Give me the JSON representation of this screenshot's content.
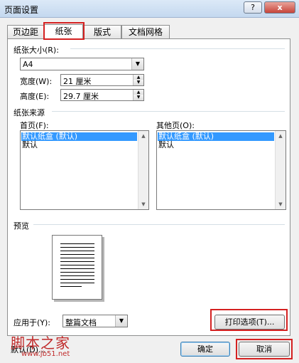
{
  "window": {
    "title": "页面设置",
    "help_label": "?",
    "close_label": "x"
  },
  "tabs": [
    {
      "label": "页边距"
    },
    {
      "label": "纸张"
    },
    {
      "label": "版式"
    },
    {
      "label": "文档网格"
    }
  ],
  "paper_size": {
    "label": "纸张大小(R):",
    "value": "A4",
    "width_label": "宽度(W):",
    "width_value": "21 厘米",
    "height_label": "高度(E):",
    "height_value": "29.7 厘米"
  },
  "paper_source": {
    "label": "纸张来源",
    "first_page_label": "首页(F):",
    "other_pages_label": "其他页(O):",
    "first_page_items": [
      "默认纸盒 (默认)",
      "默认"
    ],
    "other_pages_items": [
      "默认纸盒 (默认)",
      "默认"
    ]
  },
  "preview": {
    "label": "预览"
  },
  "apply_to": {
    "label": "应用于(Y):",
    "value": "整篇文档"
  },
  "buttons": {
    "print_options": "打印选项(T)...",
    "default": "默认(D)...",
    "ok": "确定",
    "cancel": "取消"
  },
  "watermark": {
    "text": "脚本之家",
    "url": "www.jb51.net"
  }
}
